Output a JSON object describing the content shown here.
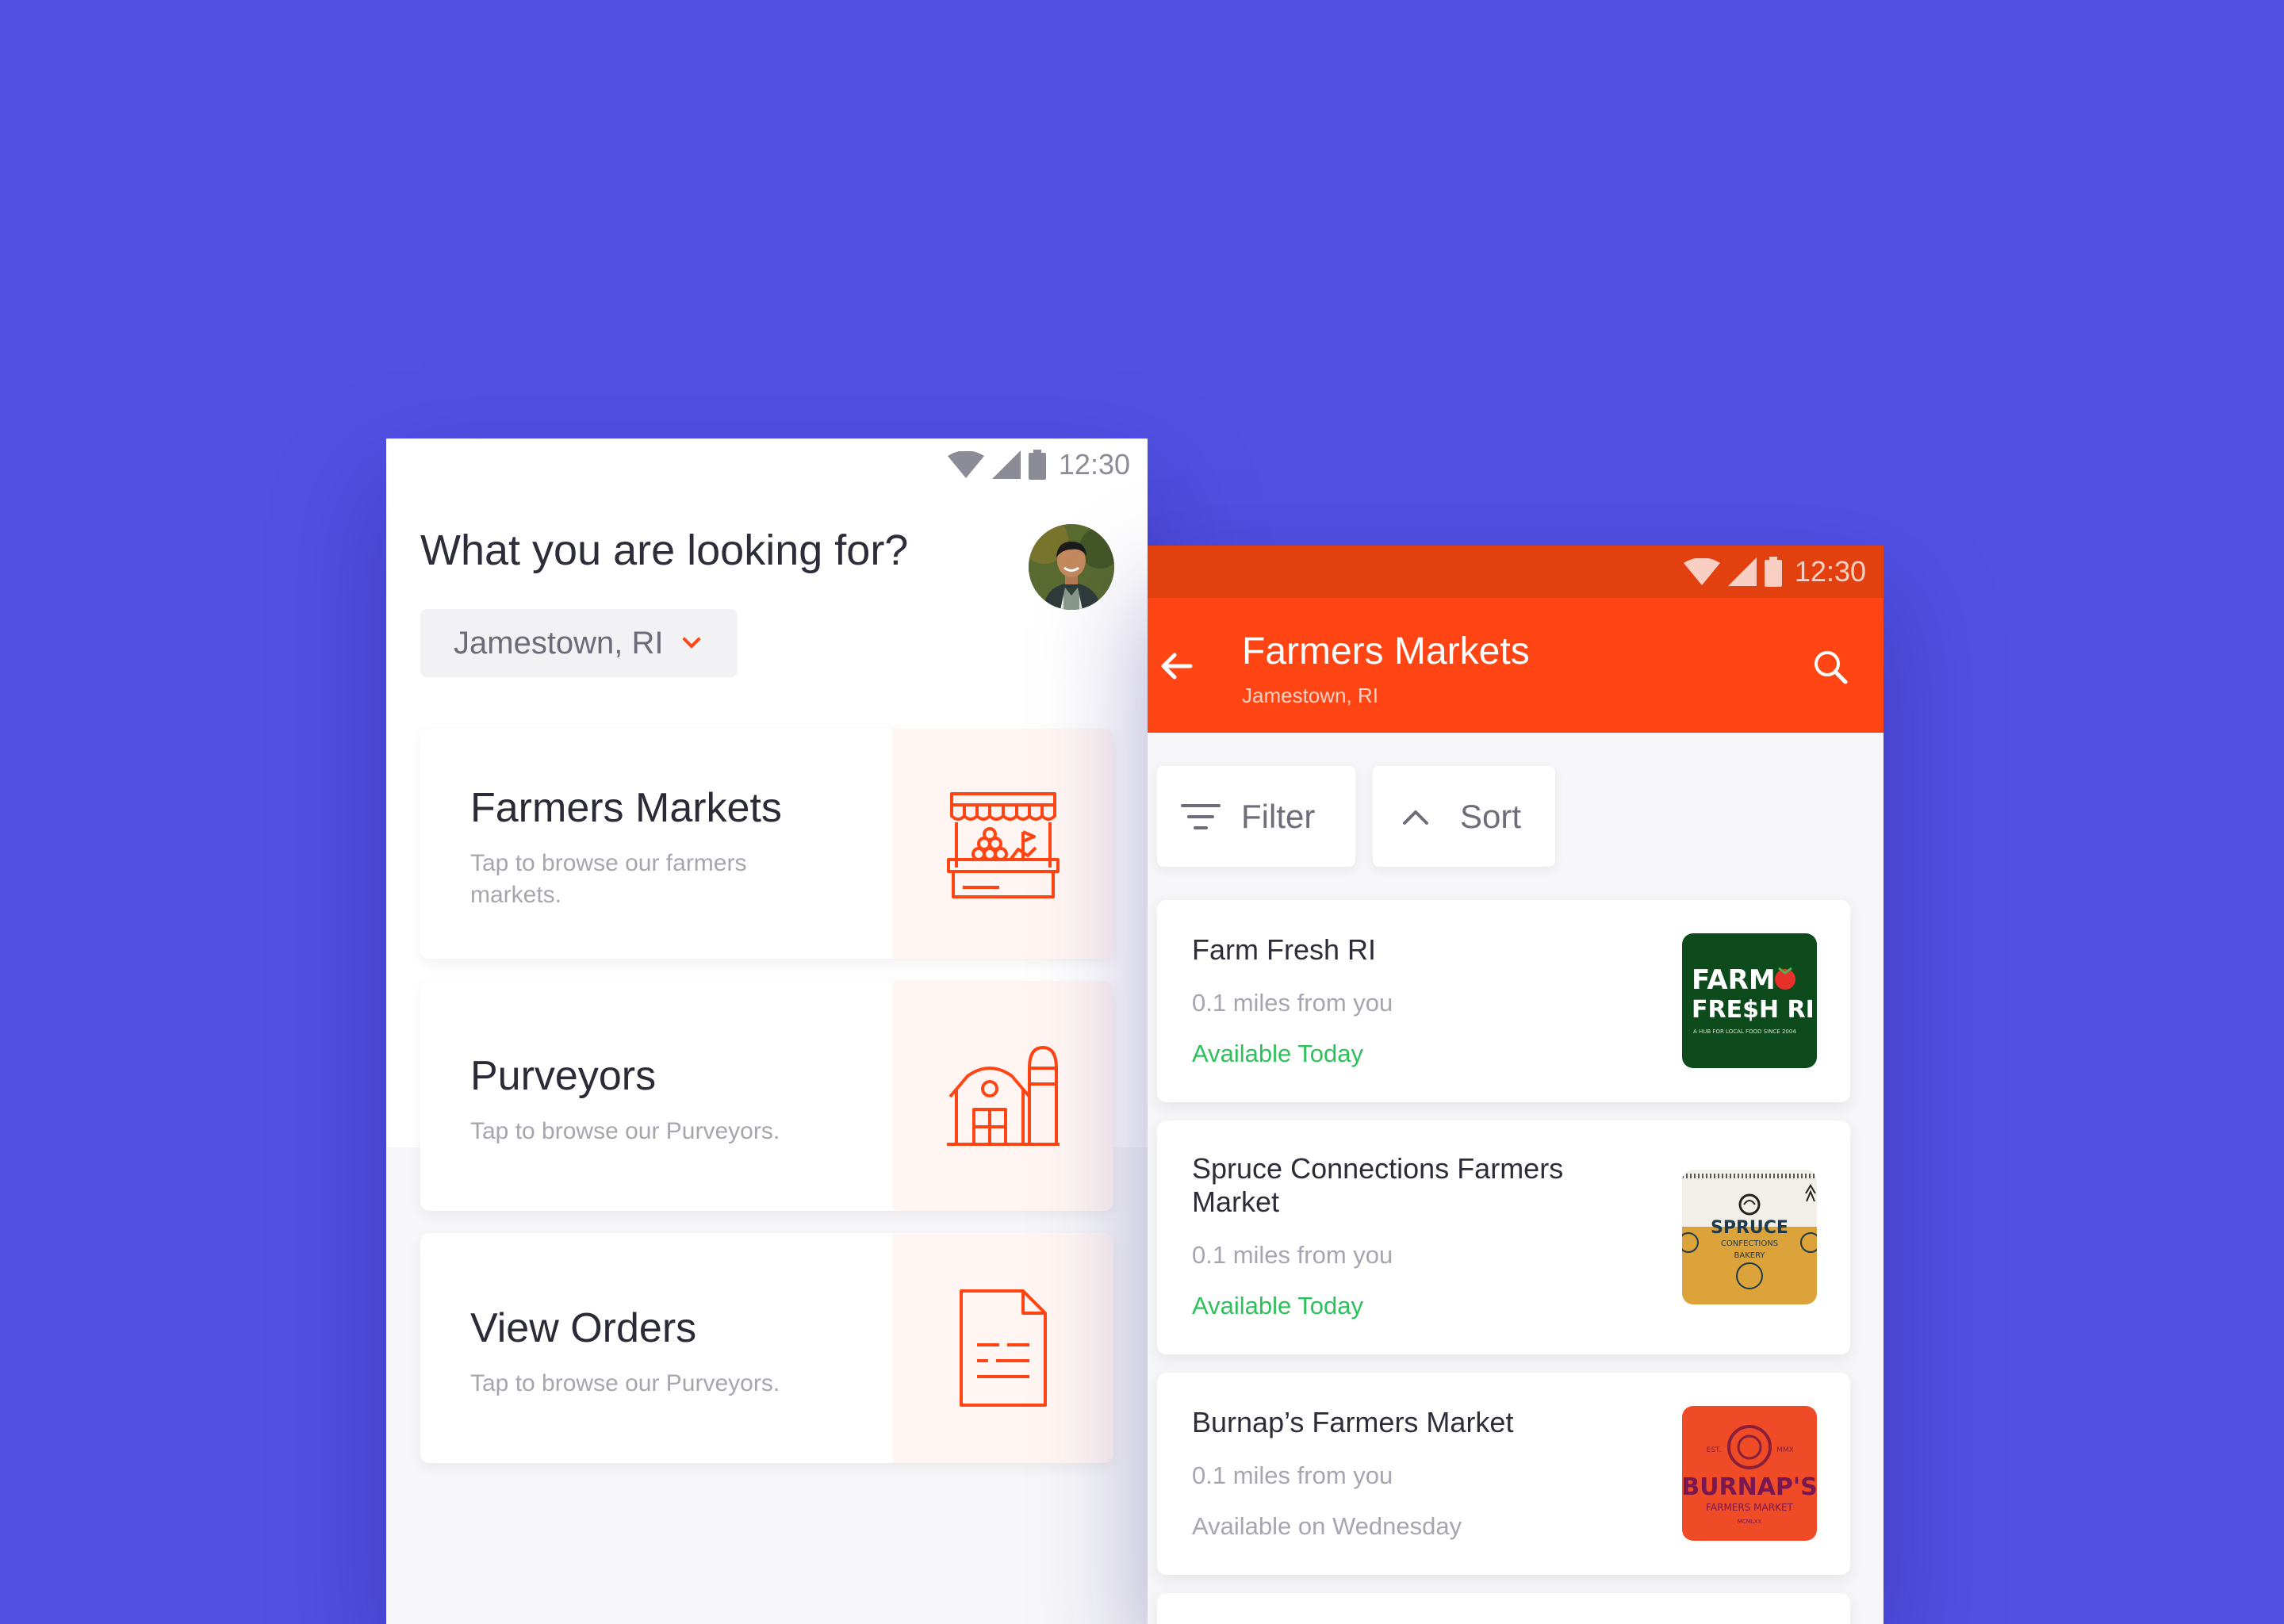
{
  "status_bar": {
    "time": "12:30"
  },
  "home": {
    "headline": "What you are looking for?",
    "location": "Jamestown, RI",
    "cards": [
      {
        "title": "Farmers Markets",
        "subtitle": "Tap to browse our farmers markets.",
        "icon": "market-stall-icon"
      },
      {
        "title": "Purveyors",
        "subtitle": "Tap to browse our Purveyors.",
        "icon": "barn-icon"
      },
      {
        "title": "View Orders",
        "subtitle": "Tap to browse our Purveyors.",
        "icon": "document-icon"
      }
    ]
  },
  "markets_screen": {
    "title": "Farmers Markets",
    "subtitle": "Jamestown, RI",
    "filter_label": "Filter",
    "sort_label": "Sort",
    "items": [
      {
        "name": "Farm Fresh RI",
        "distance": "0.1 miles from you",
        "availability": "Available Today",
        "available_today": true,
        "logo": {
          "line1": "FARM",
          "line2": "FRESH RI",
          "tagline": "A HUB FOR LOCAL FOOD SINCE 2004"
        }
      },
      {
        "name": "Spruce Connections Farmers Market",
        "distance": "0.1 miles from you",
        "availability": "Available Today",
        "available_today": true,
        "logo": {
          "line1": "SPRUCE",
          "line2": "CONFECTIONS",
          "line3": "BAKERY"
        }
      },
      {
        "name": "Burnap’s Farmers Market",
        "distance": "0.1 miles from you",
        "availability": "Available on Wednesday",
        "available_today": false,
        "logo": {
          "line1": "BURNAP'S",
          "line2": "FARMERS MARKET",
          "est": "EST.",
          "year": "MMX",
          "roman": "MCMLXX"
        }
      }
    ]
  },
  "colors": {
    "background": "#5150e3",
    "accent": "#ff4514",
    "status_dark": "#e2400e",
    "available": "#2ec05a",
    "muted": "#a6a6b0"
  }
}
